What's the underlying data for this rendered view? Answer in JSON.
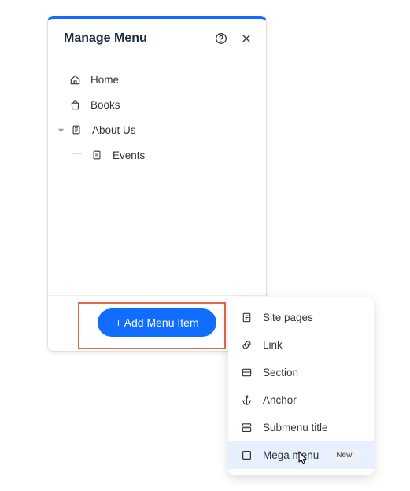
{
  "panel": {
    "title": "Manage Menu",
    "help_tooltip": "?",
    "add_button": "+ Add Menu Item"
  },
  "tree": {
    "home": "Home",
    "books": "Books",
    "about": "About Us",
    "events": "Events"
  },
  "flyout": {
    "site_pages": "Site pages",
    "link": "Link",
    "section": "Section",
    "anchor": "Anchor",
    "submenu": "Submenu title",
    "mega_menu": "Mega menu",
    "badge_new": "New!"
  }
}
